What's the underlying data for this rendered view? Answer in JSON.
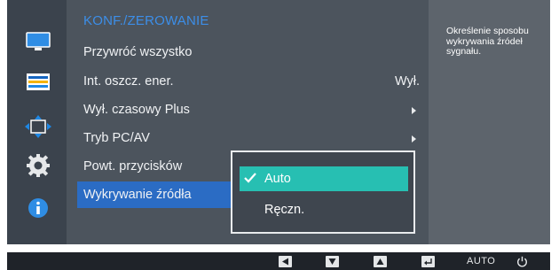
{
  "sidebar": {
    "icons": [
      {
        "name": "picture-icon",
        "color": "#2196f3"
      },
      {
        "name": "color-icon",
        "color": "#1565c0"
      },
      {
        "name": "size-position-icon",
        "color": "#1e88e5"
      },
      {
        "name": "system-icon",
        "color": "#e0e0e0"
      },
      {
        "name": "information-icon",
        "color": "#1e88e5"
      }
    ]
  },
  "menu": {
    "title": "KONF./ZEROWANIE",
    "items": [
      {
        "label": "Przywróć wszystko",
        "value": "",
        "has_arrow": false
      },
      {
        "label": "Int. oszcz. ener.",
        "value": "Wył.",
        "has_arrow": false
      },
      {
        "label": "Wył. czasowy Plus",
        "value": "",
        "has_arrow": true
      },
      {
        "label": "Tryb PC/AV",
        "value": "",
        "has_arrow": true
      },
      {
        "label": "Powt. przycisków",
        "value": "",
        "has_arrow": false
      },
      {
        "label": "Wykrywanie źródła",
        "value": "",
        "has_arrow": false,
        "selected": true
      }
    ]
  },
  "dropdown": {
    "options": [
      {
        "label": "Auto",
        "checked": true
      },
      {
        "label": "Ręczn.",
        "checked": false
      }
    ]
  },
  "help": {
    "text": "Określenie sposobu wykrywania źródeł sygnału."
  },
  "bottom_bar": {
    "buttons": [
      {
        "name": "left-button",
        "icon": "triangle-left"
      },
      {
        "name": "down-button",
        "icon": "triangle-down"
      },
      {
        "name": "up-button",
        "icon": "triangle-up"
      },
      {
        "name": "enter-button",
        "icon": "enter-return"
      },
      {
        "name": "auto-button",
        "label": "AUTO"
      },
      {
        "name": "power-button",
        "icon": "power"
      }
    ]
  },
  "colors": {
    "accent_blue": "#2b6cc4",
    "title_blue": "#3c8ee8",
    "option_teal": "#27bfb2"
  }
}
